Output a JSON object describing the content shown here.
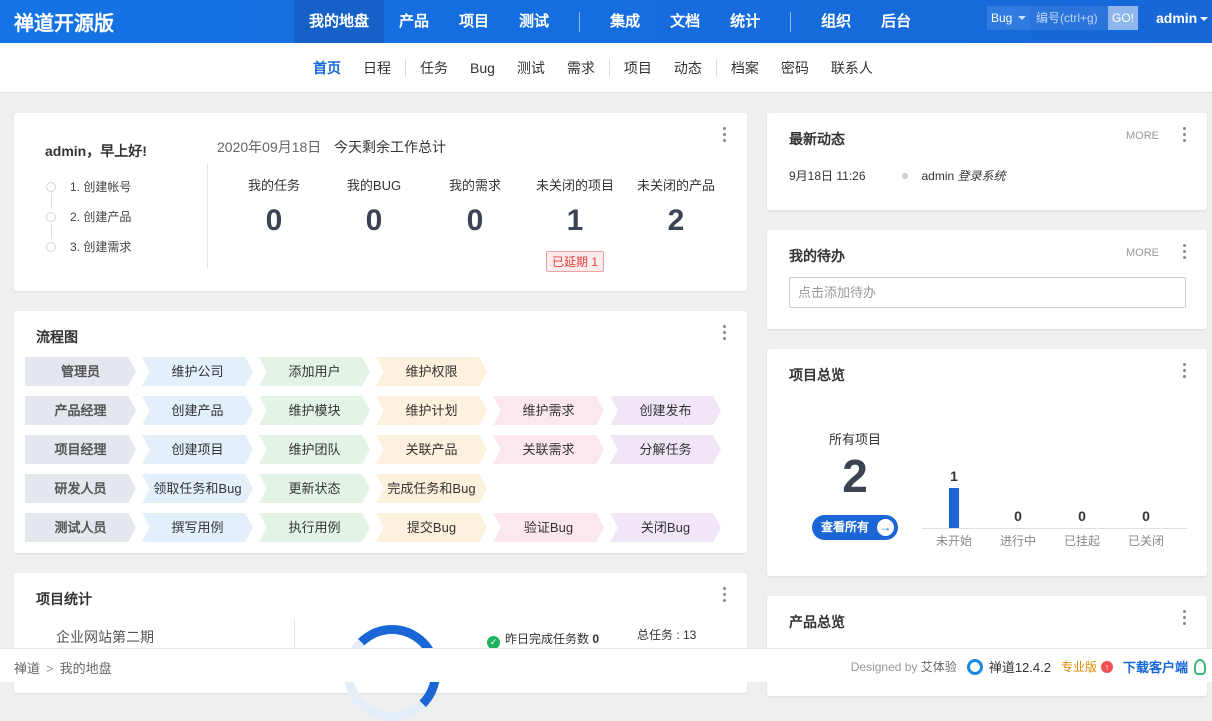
{
  "brand": "禅道开源版",
  "main_nav": [
    {
      "label": "我的地盘",
      "active": true
    },
    {
      "label": "产品"
    },
    {
      "label": "项目"
    },
    {
      "label": "测试"
    },
    {
      "label": "集成"
    },
    {
      "label": "文档"
    },
    {
      "label": "统计"
    },
    {
      "label": "组织"
    },
    {
      "label": "后台"
    }
  ],
  "search": {
    "type": "Bug",
    "placeholder": "编号(ctrl+g)",
    "go": "GO!"
  },
  "user": "admin",
  "sub_nav": [
    {
      "label": "首页",
      "active": true
    },
    {
      "label": "日程"
    },
    {
      "label": "任务"
    },
    {
      "label": "Bug"
    },
    {
      "label": "测试"
    },
    {
      "label": "需求"
    },
    {
      "label": "项目"
    },
    {
      "label": "动态"
    },
    {
      "label": "档案"
    },
    {
      "label": "密码"
    },
    {
      "label": "联系人"
    }
  ],
  "welcome": {
    "greeting": "admin，早上好!",
    "steps": [
      "1. 创建帐号",
      "2. 创建产品",
      "3. 创建需求"
    ],
    "date": "2020年09月18日",
    "remaining": "今天剩余工作总计",
    "stats": [
      {
        "label": "我的任务",
        "value": "0"
      },
      {
        "label": "我的BUG",
        "value": "0"
      },
      {
        "label": "我的需求",
        "value": "0"
      },
      {
        "label": "未关闭的项目",
        "value": "1"
      },
      {
        "label": "未关闭的产品",
        "value": "2"
      }
    ],
    "overdue": "已延期 1"
  },
  "flow": {
    "title": "流程图",
    "rows": [
      {
        "role": "管理员",
        "cells": [
          {
            "t": "维护公司",
            "c": "blue"
          },
          {
            "t": "添加用户",
            "c": "green"
          },
          {
            "t": "维护权限",
            "c": "orange"
          }
        ]
      },
      {
        "role": "产品经理",
        "cells": [
          {
            "t": "创建产品",
            "c": "blue"
          },
          {
            "t": "维护模块",
            "c": "green"
          },
          {
            "t": "维护计划",
            "c": "orange"
          },
          {
            "t": "维护需求",
            "c": "pink"
          },
          {
            "t": "创建发布",
            "c": "purple"
          }
        ]
      },
      {
        "role": "项目经理",
        "cells": [
          {
            "t": "创建项目",
            "c": "blue"
          },
          {
            "t": "维护团队",
            "c": "green"
          },
          {
            "t": "关联产品",
            "c": "orange"
          },
          {
            "t": "关联需求",
            "c": "pink"
          },
          {
            "t": "分解任务",
            "c": "purple"
          }
        ]
      },
      {
        "role": "研发人员",
        "cells": [
          {
            "t": "领取任务和Bug",
            "c": "blue"
          },
          {
            "t": "更新状态",
            "c": "green"
          },
          {
            "t": "完成任务和Bug",
            "c": "orange"
          }
        ]
      },
      {
        "role": "测试人员",
        "cells": [
          {
            "t": "撰写用例",
            "c": "blue"
          },
          {
            "t": "执行用例",
            "c": "green"
          },
          {
            "t": "提交Bug",
            "c": "orange"
          },
          {
            "t": "验证Bug",
            "c": "pink"
          },
          {
            "t": "关闭Bug",
            "c": "purple"
          }
        ]
      }
    ]
  },
  "project_stats": {
    "title": "项目统计",
    "project_name": "企业网站第二期",
    "done_yesterday_label": "昨日完成任务数",
    "done_yesterday": "0",
    "total_tasks": "总任务 : 13"
  },
  "dynamics": {
    "title": "最新动态",
    "more": "MORE",
    "items": [
      {
        "time": "9月18日 11:26",
        "user": "admin",
        "action": "登录系统"
      }
    ]
  },
  "todo": {
    "title": "我的待办",
    "more": "MORE",
    "placeholder": "点击添加待办"
  },
  "project_overview": {
    "title": "项目总览",
    "all_label": "所有项目",
    "all_value": "2",
    "view_all": "查看所有",
    "bars": [
      {
        "label": "未开始",
        "value": 1
      },
      {
        "label": "进行中",
        "value": 0
      },
      {
        "label": "已挂起",
        "value": 0
      },
      {
        "label": "已关闭",
        "value": 0
      }
    ]
  },
  "product_overview": {
    "title": "产品总览"
  },
  "footer": {
    "crumbs": [
      "禅道",
      "我的地盘"
    ],
    "designed_by": "Designed by",
    "designer": "艾体验",
    "version": "禅道12.4.2",
    "pro": "专业版",
    "download": "下载客户端"
  },
  "colors": {
    "primary": "#1467d8",
    "overdue": "#e0413e",
    "success": "#1bb35e"
  }
}
